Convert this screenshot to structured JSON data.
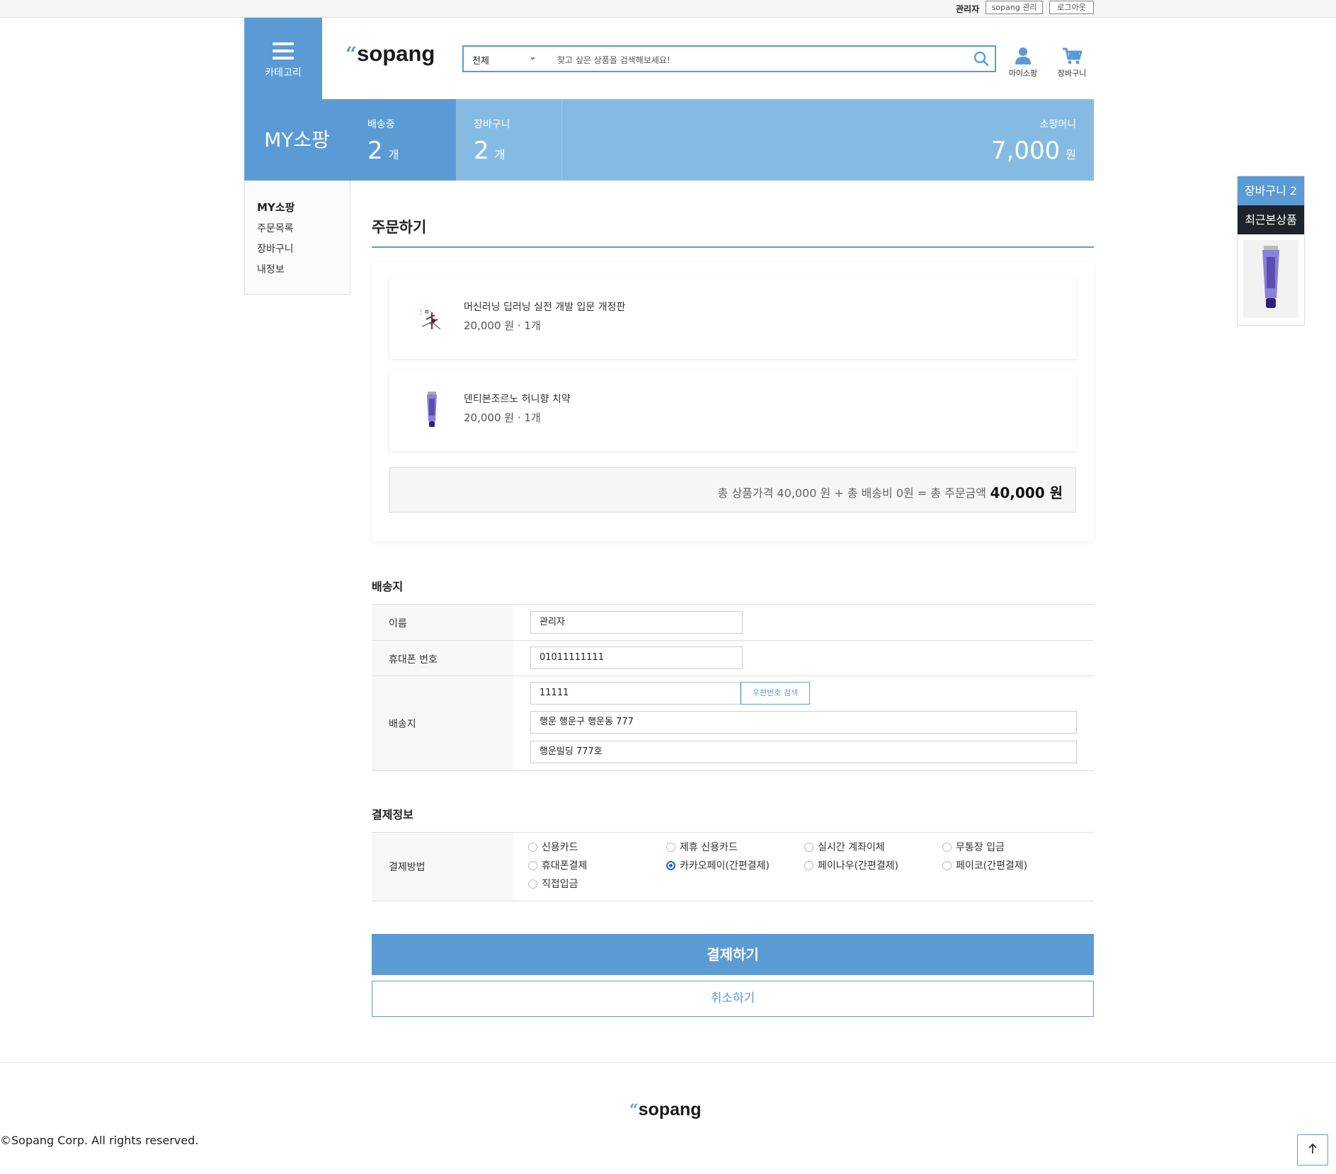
{
  "topbar": {
    "user": "관리자",
    "admin_link": "sopang 관리",
    "logout": "로그아웃"
  },
  "header": {
    "category_label": "카테고리",
    "logo": "sopang",
    "search": {
      "category": "전체",
      "placeholder": "찾고 싶은 상품을 검색해보세요!"
    },
    "mypage_label": "마이소팡",
    "cart_label": "장바구니"
  },
  "stats": {
    "title": "MY소팡",
    "shipping": {
      "label": "배송중",
      "value": "2",
      "unit": "개"
    },
    "cart": {
      "label": "장바구니",
      "value": "2",
      "unit": "개"
    },
    "money": {
      "label": "소팡머니",
      "value": "7,000",
      "unit": "원"
    }
  },
  "sidenav": {
    "heading": "MY소팡",
    "items": [
      "주문목록",
      "장바구니",
      "내정보"
    ]
  },
  "order": {
    "title": "주문하기",
    "items": [
      {
        "name": "머신러닝 딥러닝 실전 개발 입문 개정판",
        "price": "20,000 원 · 1개"
      },
      {
        "name": "덴티본조르노 허니향 치약",
        "price": "20,000 원 · 1개"
      }
    ],
    "total_text": "총 상품가격 40,000 원 + 총 배송비 0원 = 총 주문금액",
    "total_amount": "40,000 원"
  },
  "shipping": {
    "title": "배송지",
    "name_label": "이름",
    "name_value": "관리자",
    "phone_label": "휴대폰 번호",
    "phone_value": "01011111111",
    "address_label": "배송지",
    "zip_value": "11111",
    "zip_button": "우편번호 검색",
    "address1": "행운 행운구 행운동 777",
    "address2": "행운빌딩 777호"
  },
  "payment": {
    "title": "결제정보",
    "method_label": "결제방법",
    "options": [
      "신용카드",
      "제휴 신용카드",
      "실시간 계좌이체",
      "무통장 입금",
      "휴대폰결제",
      "카카오페이(간편결제)",
      "페이나우(간편결제)",
      "페이코(간편결제)",
      "직접입금"
    ],
    "selected": "카카오페이(간편결제)",
    "pay_button": "결제하기",
    "cancel_button": "취소하기"
  },
  "floating": {
    "cart": "장바구니 2",
    "recent": "최근본상품"
  },
  "footer": {
    "logo": "sopang",
    "copyright": "©Sopang Corp. All rights reserved."
  },
  "colors": {
    "accent": "#5b9bd5",
    "accent_light": "#85bbe2",
    "dark": "#1e2429"
  }
}
